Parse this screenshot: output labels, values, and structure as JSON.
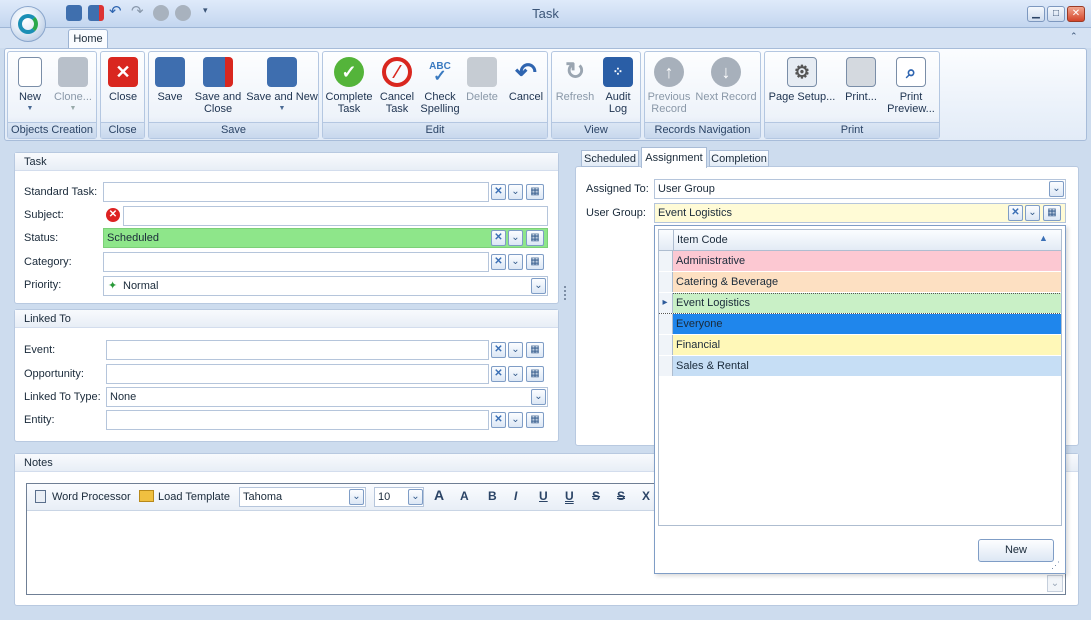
{
  "window": {
    "title": "Task"
  },
  "tabs": {
    "home": "Home"
  },
  "ribbon": {
    "new": "New",
    "clone": "Clone...",
    "close": "Close",
    "save": "Save",
    "save_close_1": "Save and",
    "save_close_2": "Close",
    "save_new": "Save and New",
    "complete_1": "Complete",
    "complete_2": "Task",
    "cancel_task_1": "Cancel",
    "cancel_task_2": "Task",
    "check_1": "Check",
    "check_2": "Spelling",
    "delete": "Delete",
    "cancel": "Cancel",
    "refresh": "Refresh",
    "audit_1": "Audit",
    "audit_2": "Log",
    "prev_1": "Previous",
    "prev_2": "Record",
    "next": "Next Record",
    "page_setup": "Page Setup...",
    "print": "Print...",
    "preview_1": "Print",
    "preview_2": "Preview...",
    "abc": "ABC",
    "groups": {
      "objects": "Objects Creation",
      "close": "Close",
      "save": "Save",
      "edit": "Edit",
      "view": "View",
      "nav": "Records Navigation",
      "print": "Print"
    }
  },
  "task": {
    "header": "Task",
    "standard_task_label": "Standard Task:",
    "standard_task_value": "",
    "subject_label": "Subject:",
    "subject_value": "",
    "status_label": "Status:",
    "status_value": "Scheduled",
    "category_label": "Category:",
    "category_value": "",
    "priority_label": "Priority:",
    "priority_value": "Normal"
  },
  "linked": {
    "header": "Linked To",
    "event_label": "Event:",
    "event_value": "",
    "opportunity_label": "Opportunity:",
    "opportunity_value": "",
    "type_label": "Linked To Type:",
    "type_value": "None",
    "entity_label": "Entity:",
    "entity_value": ""
  },
  "right_tabs": {
    "scheduled": "Scheduled",
    "assignment": "Assignment",
    "completion": "Completion"
  },
  "assignment": {
    "assigned_to_label": "Assigned To:",
    "assigned_to_value": "User Group",
    "user_group_label": "User Group:",
    "user_group_value": "Event Logistics"
  },
  "dropdown": {
    "column_header": "Item Code",
    "items": [
      {
        "label": "Administrative",
        "color": "#fcc8d2"
      },
      {
        "label": "Catering & Beverage",
        "color": "#fde0c2"
      },
      {
        "label": "Event Logistics",
        "color": "#c9f0c6"
      },
      {
        "label": "Everyone",
        "color": "#1f86ec"
      },
      {
        "label": "Financial",
        "color": "#fff8b8"
      },
      {
        "label": "Sales & Rental",
        "color": "#c6def5"
      }
    ],
    "selected_index": 2,
    "highlight_index": 3,
    "new_button": "New"
  },
  "notes": {
    "header": "Notes",
    "word_processor": "Word Processor",
    "load_template": "Load Template",
    "font": "Tahoma",
    "size": "10",
    "fmt_grow": "A",
    "fmt_shrink": "A",
    "fmt_bold": "B",
    "fmt_italic": "I",
    "fmt_underline": "U",
    "fmt_double_underline": "U",
    "fmt_strike": "S",
    "fmt_double_strike": "S",
    "fmt_sup": "X"
  },
  "colors": {
    "status_green": "#8ee68a",
    "user_group_bg": "#fffbd6"
  }
}
